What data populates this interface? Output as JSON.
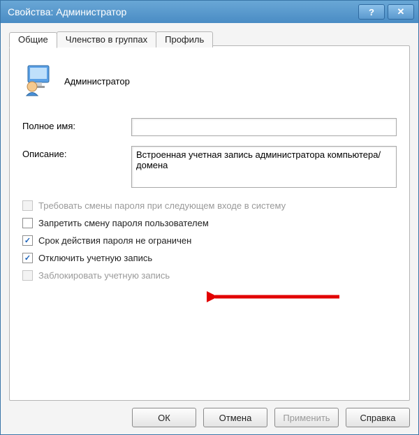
{
  "window": {
    "title": "Свойства: Администратор"
  },
  "tabs": {
    "general": "Общие",
    "membership": "Членство в группах",
    "profile": "Профиль"
  },
  "user": {
    "display_name": "Администратор"
  },
  "fields": {
    "full_name_label": "Полное имя:",
    "full_name_value": "",
    "description_label": "Описание:",
    "description_value": "Встроенная учетная запись администратора компьютера/домена"
  },
  "checkboxes": {
    "must_change": {
      "label": "Требовать смены пароля при следующем входе в систему",
      "checked": false,
      "enabled": false
    },
    "cannot_change": {
      "label": "Запретить смену пароля пользователем",
      "checked": false,
      "enabled": true
    },
    "never_expires": {
      "label": "Срок действия пароля не ограничен",
      "checked": true,
      "enabled": true
    },
    "disabled": {
      "label": "Отключить учетную запись",
      "checked": true,
      "enabled": true
    },
    "locked": {
      "label": "Заблокировать учетную запись",
      "checked": false,
      "enabled": false
    }
  },
  "buttons": {
    "ok": "ОК",
    "cancel": "Отмена",
    "apply": "Применить",
    "help": "Справка"
  }
}
